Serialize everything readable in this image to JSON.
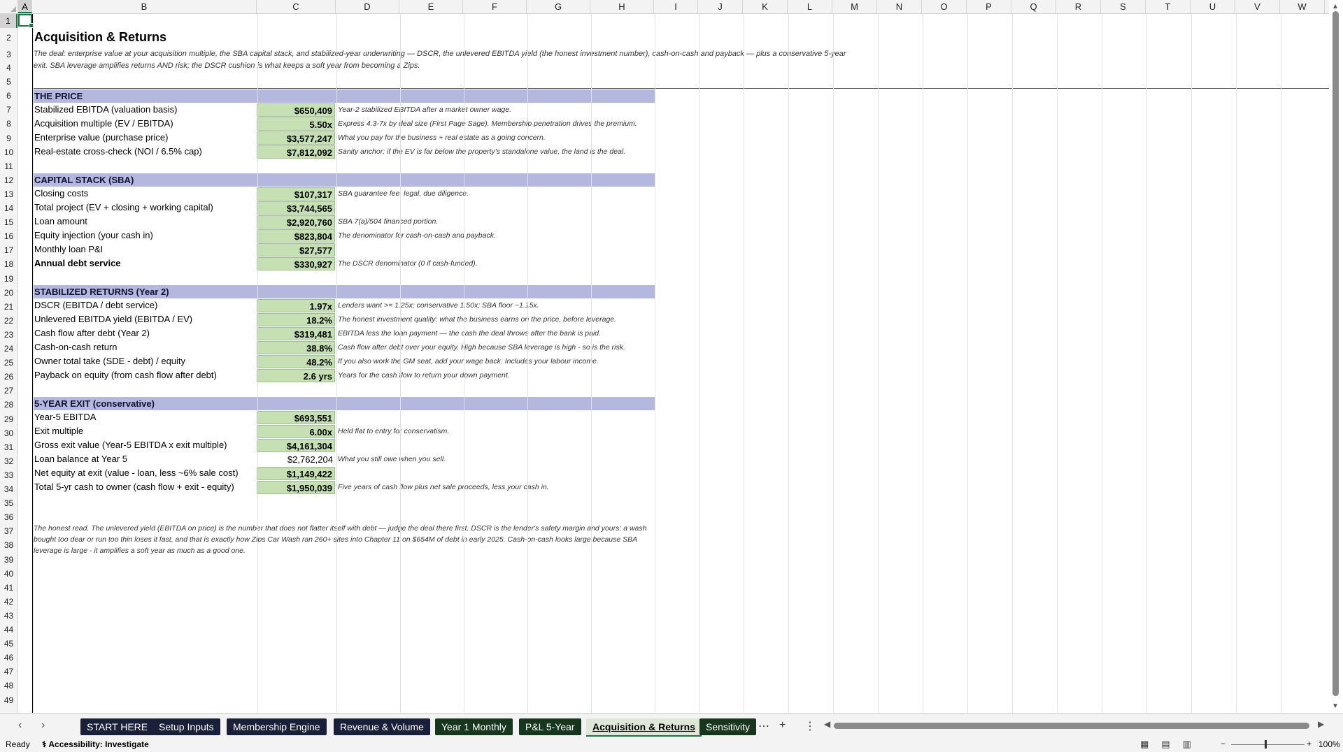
{
  "columns": [
    "A",
    "B",
    "C",
    "D",
    "E",
    "F",
    "G",
    "H",
    "I",
    "J",
    "K",
    "L",
    "M",
    "N",
    "O",
    "P",
    "Q",
    "R",
    "S",
    "T",
    "U",
    "V",
    "W"
  ],
  "rows": [
    "1",
    "2",
    "3",
    "4",
    "5",
    "6",
    "7",
    "8",
    "9",
    "10",
    "11",
    "12",
    "13",
    "14",
    "15",
    "16",
    "17",
    "18",
    "19",
    "20",
    "21",
    "22",
    "23",
    "24",
    "25",
    "26",
    "27",
    "28",
    "29",
    "30",
    "31",
    "32",
    "33",
    "34",
    "35",
    "36",
    "37",
    "38",
    "39",
    "40",
    "41",
    "42",
    "43",
    "44",
    "45",
    "46",
    "47",
    "48",
    "49"
  ],
  "title": "Acquisition & Returns",
  "subtitle_line1": "The deal: enterprise value at your acquisition multiple, the SBA capital stack, and stabilized-year underwriting — DSCR, the unlevered EBITDA yield (the honest investment number), cash-on-cash and payback — plus a conservative 5-year",
  "subtitle_line2": "exit. SBA leverage amplifies returns AND risk; the DSCR cushion is what keeps a soft year from becoming a Zips.",
  "sections": {
    "price": {
      "header": "THE PRICE",
      "rows": [
        {
          "label": "Stabilized EBITDA (valuation basis)",
          "value": "$650,409",
          "note": "Year-2 stabilized EBITDA after a market owner wage."
        },
        {
          "label": "Acquisition multiple (EV / EBITDA)",
          "value": "5.50x",
          "note": "Express 4.3-7x by deal size (First Page Sage). Membership penetration drives the premium."
        },
        {
          "label": "Enterprise value (purchase price)",
          "value": "$3,577,247",
          "note": "What you pay for the business + real estate as a going concern."
        },
        {
          "label": "Real-estate cross-check (NOI / 6.5% cap)",
          "value": "$7,812,092",
          "note": "Sanity anchor: if the EV is far below the property's standalone value, the land is the deal."
        }
      ]
    },
    "capital": {
      "header": "CAPITAL STACK (SBA)",
      "rows": [
        {
          "label": "Closing costs",
          "value": "$107,317",
          "note": "SBA guarantee fee, legal, due diligence."
        },
        {
          "label": "Total project (EV + closing + working capital)",
          "value": "$3,744,565",
          "note": ""
        },
        {
          "label": "Loan amount",
          "value": "$2,920,760",
          "note": "SBA 7(a)/504 financed portion."
        },
        {
          "label": "Equity injection (your cash in)",
          "value": "$823,804",
          "note": "The denominator for cash-on-cash and payback."
        },
        {
          "label": "Monthly loan P&I",
          "value": "$27,577",
          "note": ""
        },
        {
          "label": "Annual debt service",
          "value": "$330,927",
          "note": "The DSCR denominator (0 if cash-funded)."
        }
      ]
    },
    "returns": {
      "header": "STABILIZED RETURNS (Year 2)",
      "rows": [
        {
          "label": "DSCR (EBITDA / debt service)",
          "value": "1.97x",
          "note": "Lenders want >= 1.25x; conservative 1.50x; SBA floor ~1.15x."
        },
        {
          "label": "Unlevered EBITDA yield (EBITDA / EV)",
          "value": "18.2%",
          "note": "The honest investment quality: what the business earns on the price, before leverage."
        },
        {
          "label": "Cash flow after debt (Year 2)",
          "value": "$319,481",
          "note": "EBITDA less the loan payment — the cash the deal throws after the bank is paid."
        },
        {
          "label": "Cash-on-cash return",
          "value": "38.8%",
          "note": "Cash flow after debt over your equity. High because SBA leverage is high - so is the risk."
        },
        {
          "label": "Owner total take (SDE - debt) / equity",
          "value": "48.2%",
          "note": "If you also work the GM seat, add your wage back. Includes your labour income."
        },
        {
          "label": "Payback on equity (from cash flow after debt)",
          "value": "2.6 yrs",
          "note": "Years for the cash flow to return your down payment."
        }
      ]
    },
    "exit": {
      "header": "5-YEAR EXIT (conservative)",
      "rows": [
        {
          "label": "Year-5 EBITDA",
          "value": "$693,551",
          "note": ""
        },
        {
          "label": "Exit multiple",
          "value": "6.00x",
          "note": "Held flat to entry for conservatism."
        },
        {
          "label": "Gross exit value (Year-5 EBITDA x exit multiple)",
          "value": "$4,161,304",
          "note": ""
        },
        {
          "label": "Loan balance at Year 5",
          "value": "$2,762,204",
          "note": "What you still owe when you sell."
        },
        {
          "label": "Net equity at exit (value - loan, less ~6% sale cost)",
          "value": "$1,149,422",
          "note": ""
        },
        {
          "label": "Total 5-yr cash to owner (cash flow + exit - equity)",
          "value": "$1,950,039",
          "note": "Five years of cash flow plus net sale proceeds, less your cash in."
        }
      ]
    }
  },
  "closing_paragraph": "The honest read. The unlevered yield (EBITDA on price) is the number that does not flatter itself with debt — judge the deal there first. DSCR is the lender's safety margin and yours: a wash bought too dear or run too thin loses it fast, and that is exactly how Zips Car Wash ran 260+ sites into Chapter 11 on $654M of debt in early 2025. Cash-on-cash looks large because SBA leverage is large - it amplifies a soft year as much as a good one.",
  "tabs": [
    "START HERE",
    "Setup Inputs",
    "Membership Engine",
    "Revenue & Volume",
    "Year 1 Monthly",
    "P&L 5-Year",
    "Acquisition & Returns",
    "Sensitivity"
  ],
  "status": {
    "ready": "Ready",
    "accessibility": "Accessibility: Investigate",
    "zoom": "100%"
  }
}
